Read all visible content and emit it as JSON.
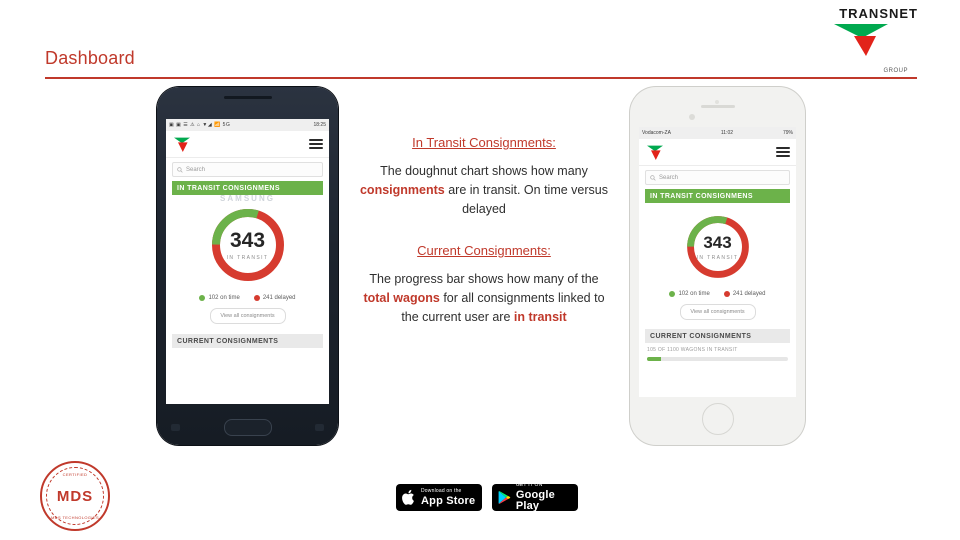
{
  "slide": {
    "title": "Dashboard"
  },
  "brand": {
    "wordmark": "TRANSNET",
    "tagline": "GROUP",
    "mark_color": "#00a94f",
    "accent_color": "#c0392b"
  },
  "copy": {
    "section1_heading": "In Transit Consignments:",
    "section1_body_a": "The doughnut chart shows how many ",
    "section1_body_em": "consignments",
    "section1_body_b": " are in transit. On time versus delayed",
    "section2_heading": "Current Consignments:",
    "section2_body_a": "The progress bar shows how many of the ",
    "section2_body_em": "total wagons",
    "section2_body_b": " for all consignments linked to the current user are ",
    "section2_body_em2": "in transit"
  },
  "phone_samsung": {
    "device_brand": "SAMSUNG",
    "status_time": "18:25",
    "status_icons": "▣ ▣ ☰ ⚠ ⌂  ▼◢ 📶 5G",
    "search_placeholder": "Search",
    "section_in_transit": "IN TRANSIT CONSIGNMENS",
    "donut_value": "343",
    "donut_label": "IN TRANSIT",
    "legend_ontime": "102 on time",
    "legend_delayed": "241 delayed",
    "view_all_button": "View all consignments",
    "section_current": "CURRENT CONSIGNMENTS"
  },
  "phone_iphone": {
    "status_carrier": "Vodacom-ZA",
    "status_time": "11:02",
    "status_battery": "79%",
    "search_placeholder": "Search",
    "section_in_transit": "IN TRANSIT CONSIGNMENS",
    "donut_value": "343",
    "donut_label": "IN TRANSIT",
    "legend_ontime": "102 on time",
    "legend_delayed": "241 delayed",
    "view_all_button": "View all consignments",
    "section_current": "CURRENT CONSIGNMENTS",
    "progress_caption": "105 OF 1100 WAGONS IN TRANSIT",
    "progress_percent": 10
  },
  "chart_data": {
    "type": "pie",
    "title": "IN TRANSIT",
    "categories": [
      "on time",
      "delayed"
    ],
    "values": [
      102,
      241
    ],
    "total": 343,
    "colors": [
      "#6cb24a",
      "#d63b2f"
    ],
    "legend": [
      "102 on time",
      "241 delayed"
    ]
  },
  "mds": {
    "logo_text": "MDS",
    "top_text": "CERTIFIED",
    "bottom_text": "MDS TECHNOLOGIES"
  },
  "stores": [
    {
      "icon": "apple-icon",
      "small_label": "Download on the",
      "big_label": "App Store"
    },
    {
      "icon": "google-play-icon",
      "small_label": "GET IT ON",
      "big_label": "Google Play"
    }
  ]
}
